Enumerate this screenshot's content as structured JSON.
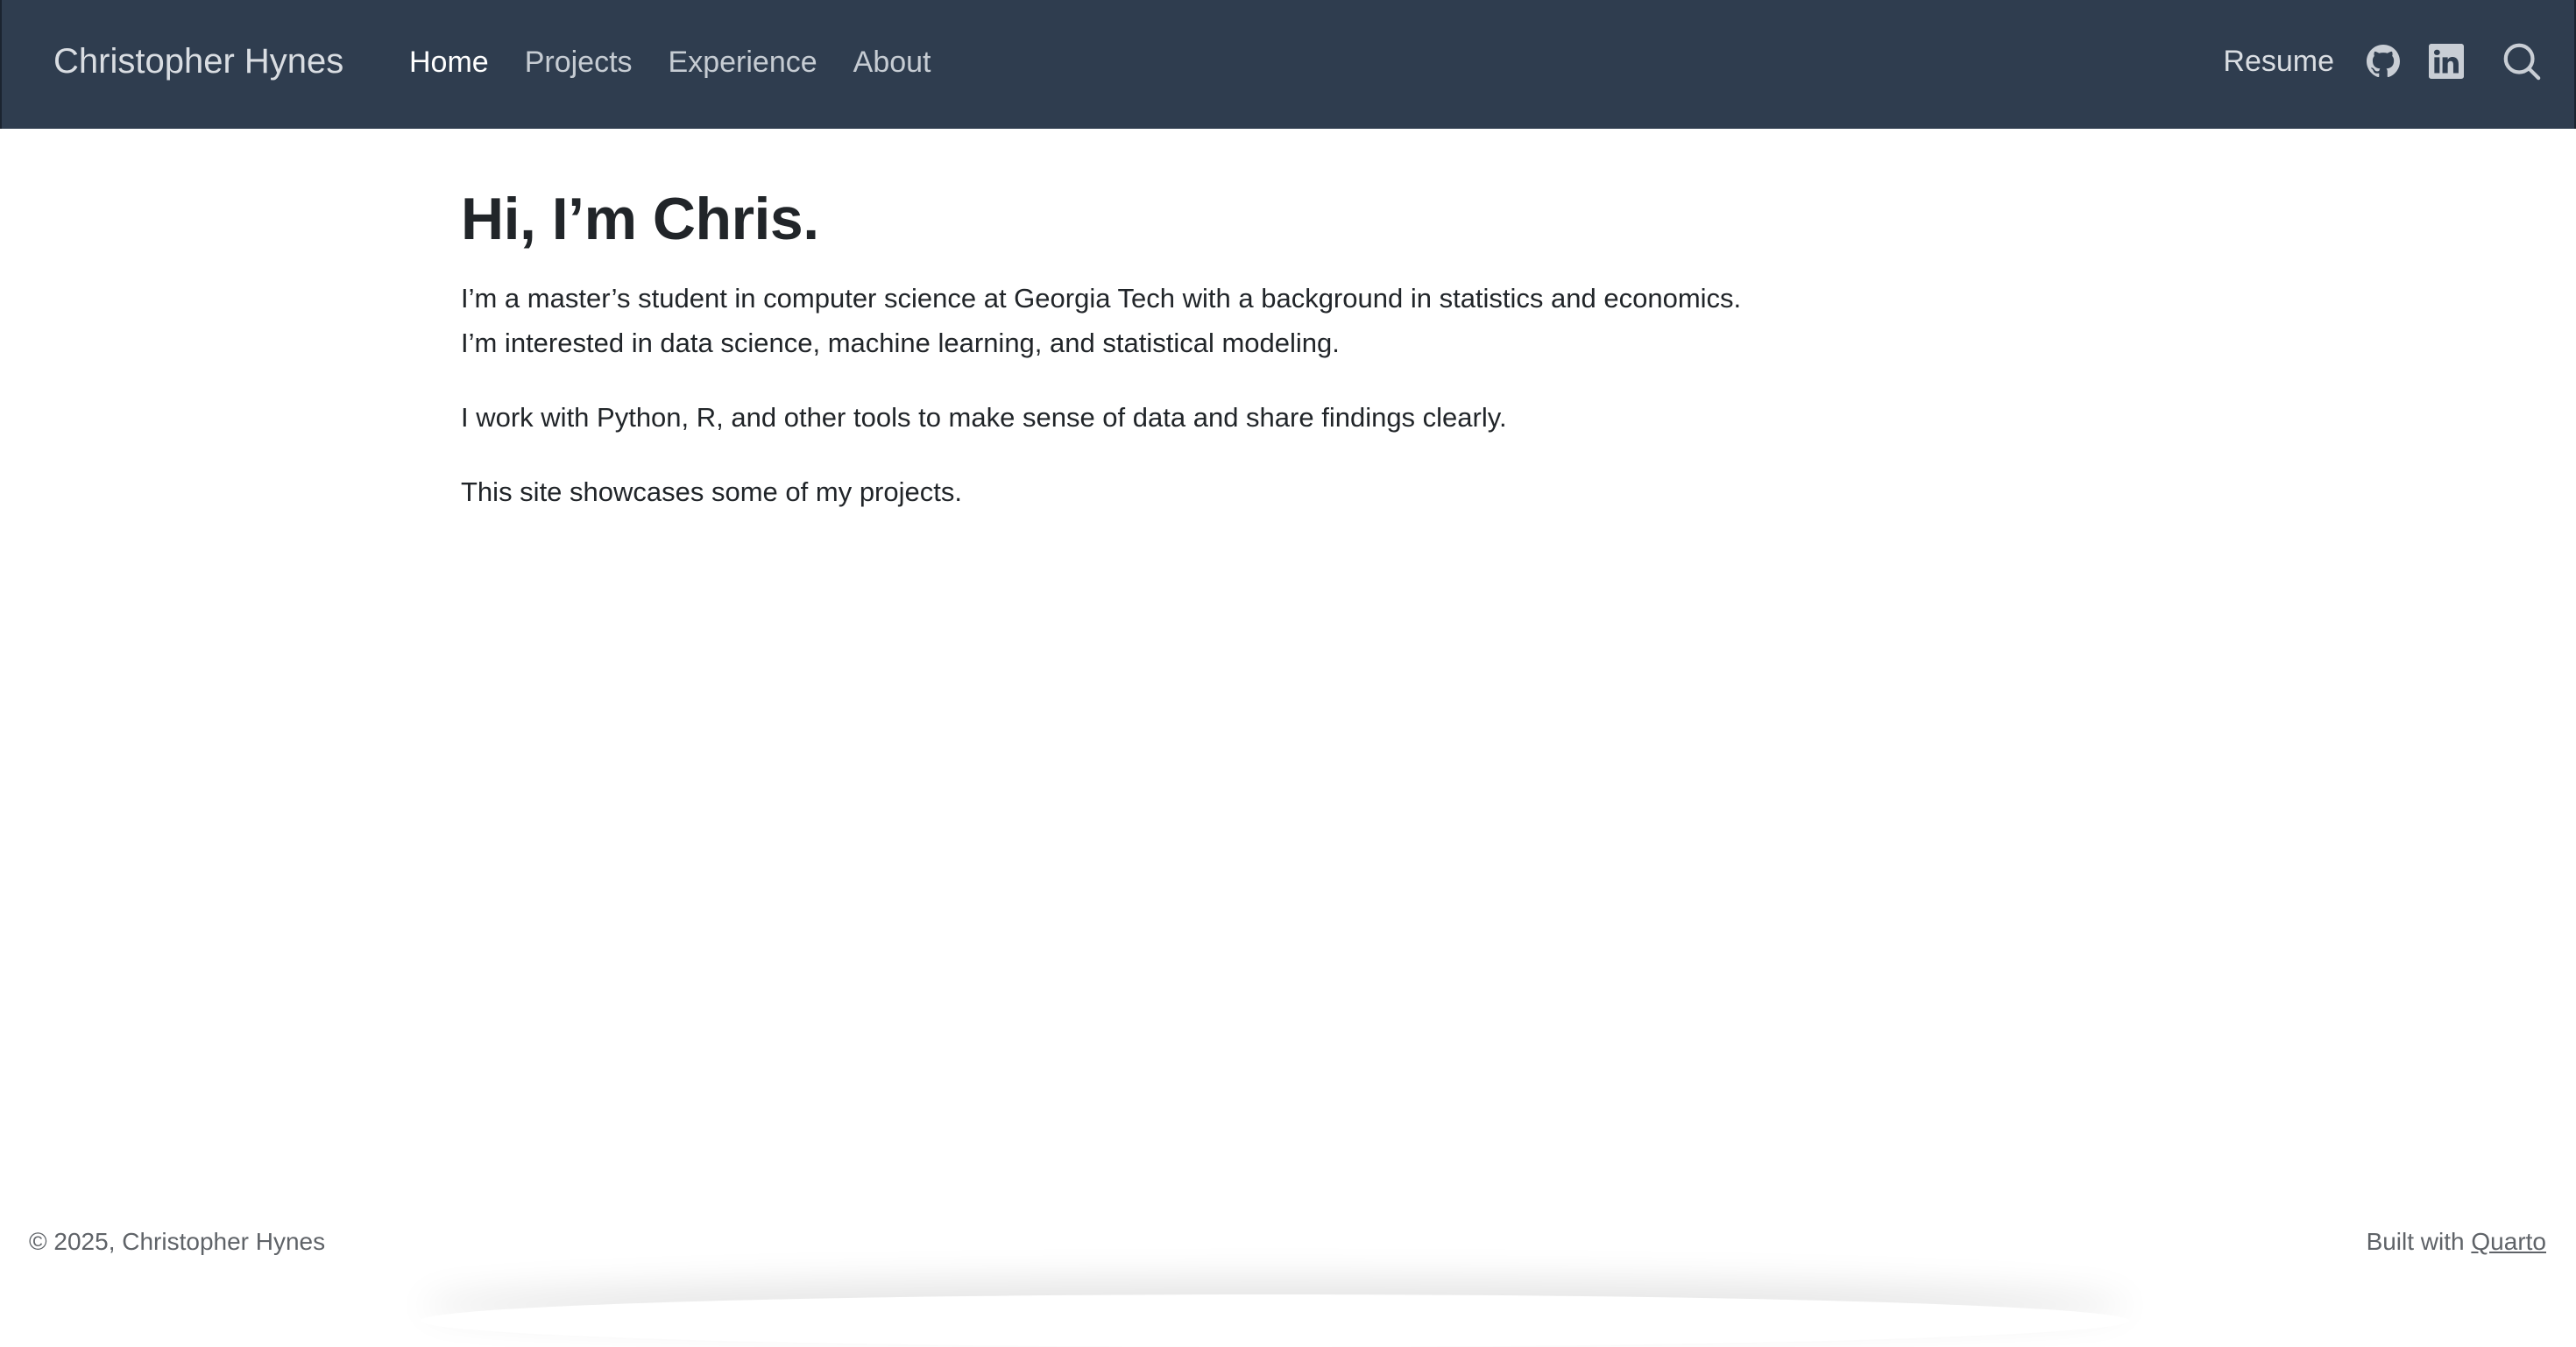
{
  "navbar": {
    "brand": "Christopher Hynes",
    "links": [
      {
        "label": "Home",
        "active": true
      },
      {
        "label": "Projects",
        "active": false
      },
      {
        "label": "Experience",
        "active": false
      },
      {
        "label": "About",
        "active": false
      }
    ],
    "resume_label": "Resume",
    "icons": [
      "github-icon",
      "linkedin-icon",
      "search-icon"
    ],
    "background_color": "#2f3d4f"
  },
  "main": {
    "title": "Hi, I’m Chris.",
    "paragraph_1_line_1": "I’m a master’s student in computer science at Georgia Tech with a background in statistics and economics.",
    "paragraph_1_line_2": "I’m interested in data science, machine learning, and statistical modeling.",
    "paragraph_2": "I work with Python, R, and other tools to make sense of data and share findings clearly.",
    "paragraph_3": "This site showcases some of my projects."
  },
  "footer": {
    "copyright": "© 2025, Christopher Hynes",
    "built_with_prefix": "Built with ",
    "built_with_link": "Quarto"
  }
}
